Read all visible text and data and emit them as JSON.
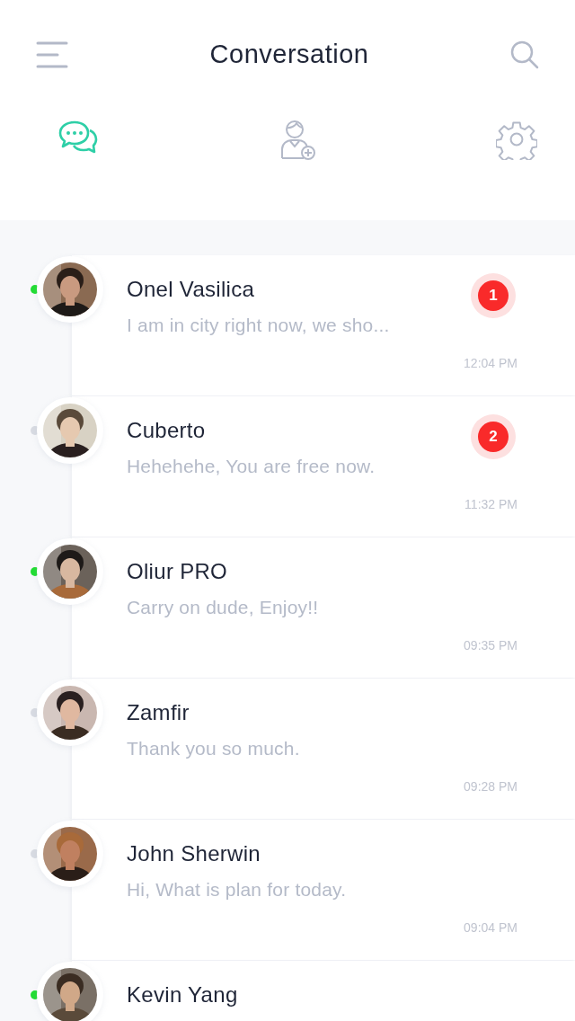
{
  "header": {
    "title": "Conversation"
  },
  "tabs": [
    {
      "kind": "chats",
      "selected": true
    },
    {
      "kind": "contacts",
      "selected": false
    },
    {
      "kind": "settings",
      "selected": false
    }
  ],
  "conversations": [
    {
      "name": "Onel Vasilica",
      "message": "I am in city right now, we sho...",
      "time": "12:04 PM",
      "online": true,
      "unread": "1"
    },
    {
      "name": "Cuberto",
      "message": "Hehehehe, You are free now.",
      "time": "11:32 PM",
      "online": false,
      "unread": "2"
    },
    {
      "name": "Oliur PRO",
      "message": "Carry on dude, Enjoy!!",
      "time": "09:35 PM",
      "online": true
    },
    {
      "name": "Zamfir",
      "message": "Thank you so much.",
      "time": "09:28 PM",
      "online": false
    },
    {
      "name": "John Sherwin",
      "message": "Hi, What is plan for today.",
      "time": "09:04 PM",
      "online": false
    },
    {
      "name": "Kevin Yang",
      "online": true
    }
  ]
}
